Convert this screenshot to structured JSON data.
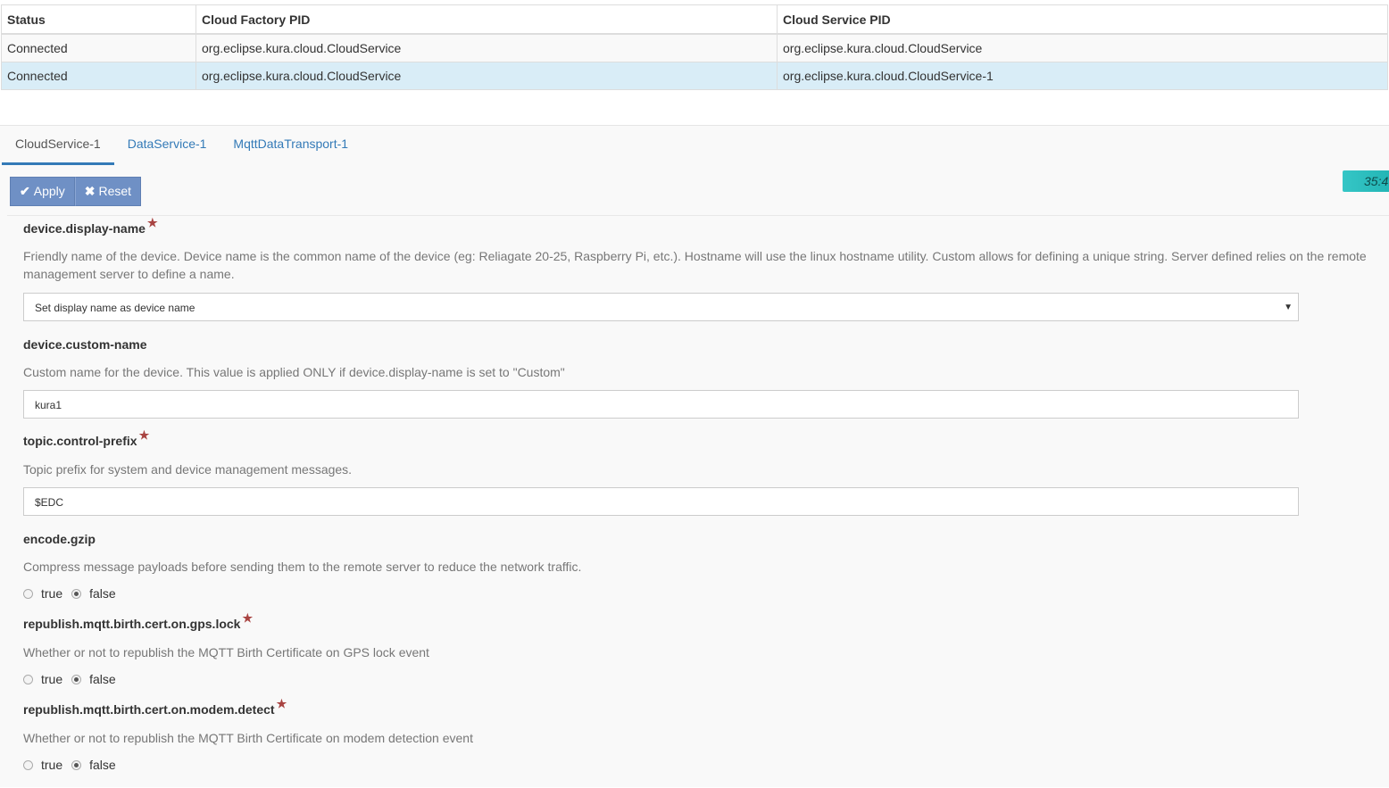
{
  "table": {
    "headers": [
      "Status",
      "Cloud Factory PID",
      "Cloud Service PID"
    ],
    "rows": [
      {
        "status": "Connected",
        "factory": "org.eclipse.kura.cloud.CloudService",
        "service": "org.eclipse.kura.cloud.CloudService"
      },
      {
        "status": "Connected",
        "factory": "org.eclipse.kura.cloud.CloudService",
        "service": "org.eclipse.kura.cloud.CloudService-1"
      }
    ]
  },
  "tabs": [
    "CloudService-1",
    "DataService-1",
    "MqttDataTransport-1"
  ],
  "toolbar": {
    "apply_label": "Apply",
    "reset_label": "Reset",
    "apply_icon": "check-icon",
    "reset_icon": "x-icon"
  },
  "timer": "35:4",
  "fields": {
    "display_name": {
      "label": "device.display-name",
      "desc": "Friendly name of the device. Device name is the common name of the device (eg: Reliagate 20-25, Raspberry Pi, etc.). Hostname will use the linux hostname utility. Custom allows for defining a unique string. Server defined relies on the remote management server to define a name.",
      "value": "Set display name as device name"
    },
    "custom_name": {
      "label": "device.custom-name",
      "desc": "Custom name for the device. This value is applied ONLY if device.display-name is set to \"Custom\"",
      "value": "kura1"
    },
    "control_prefix": {
      "label": "topic.control-prefix",
      "desc": "Topic prefix for system and device management messages.",
      "value": "$EDC"
    },
    "gzip": {
      "label": "encode.gzip",
      "desc": "Compress message payloads before sending them to the remote server to reduce the network traffic.",
      "value": "false"
    },
    "gps_lock": {
      "label": "republish.mqtt.birth.cert.on.gps.lock",
      "desc": "Whether or not to republish the MQTT Birth Certificate on GPS lock event",
      "value": "false"
    },
    "modem_detect": {
      "label": "republish.mqtt.birth.cert.on.modem.detect",
      "desc": "Whether or not to republish the MQTT Birth Certificate on modem detection event",
      "value": "false"
    }
  },
  "radio_labels": {
    "true": "true",
    "false": "false"
  },
  "colors": {
    "accent": "#337ab7",
    "selected_row": "#d9edf7",
    "button": "#6f90c5",
    "required": "#a94442"
  }
}
